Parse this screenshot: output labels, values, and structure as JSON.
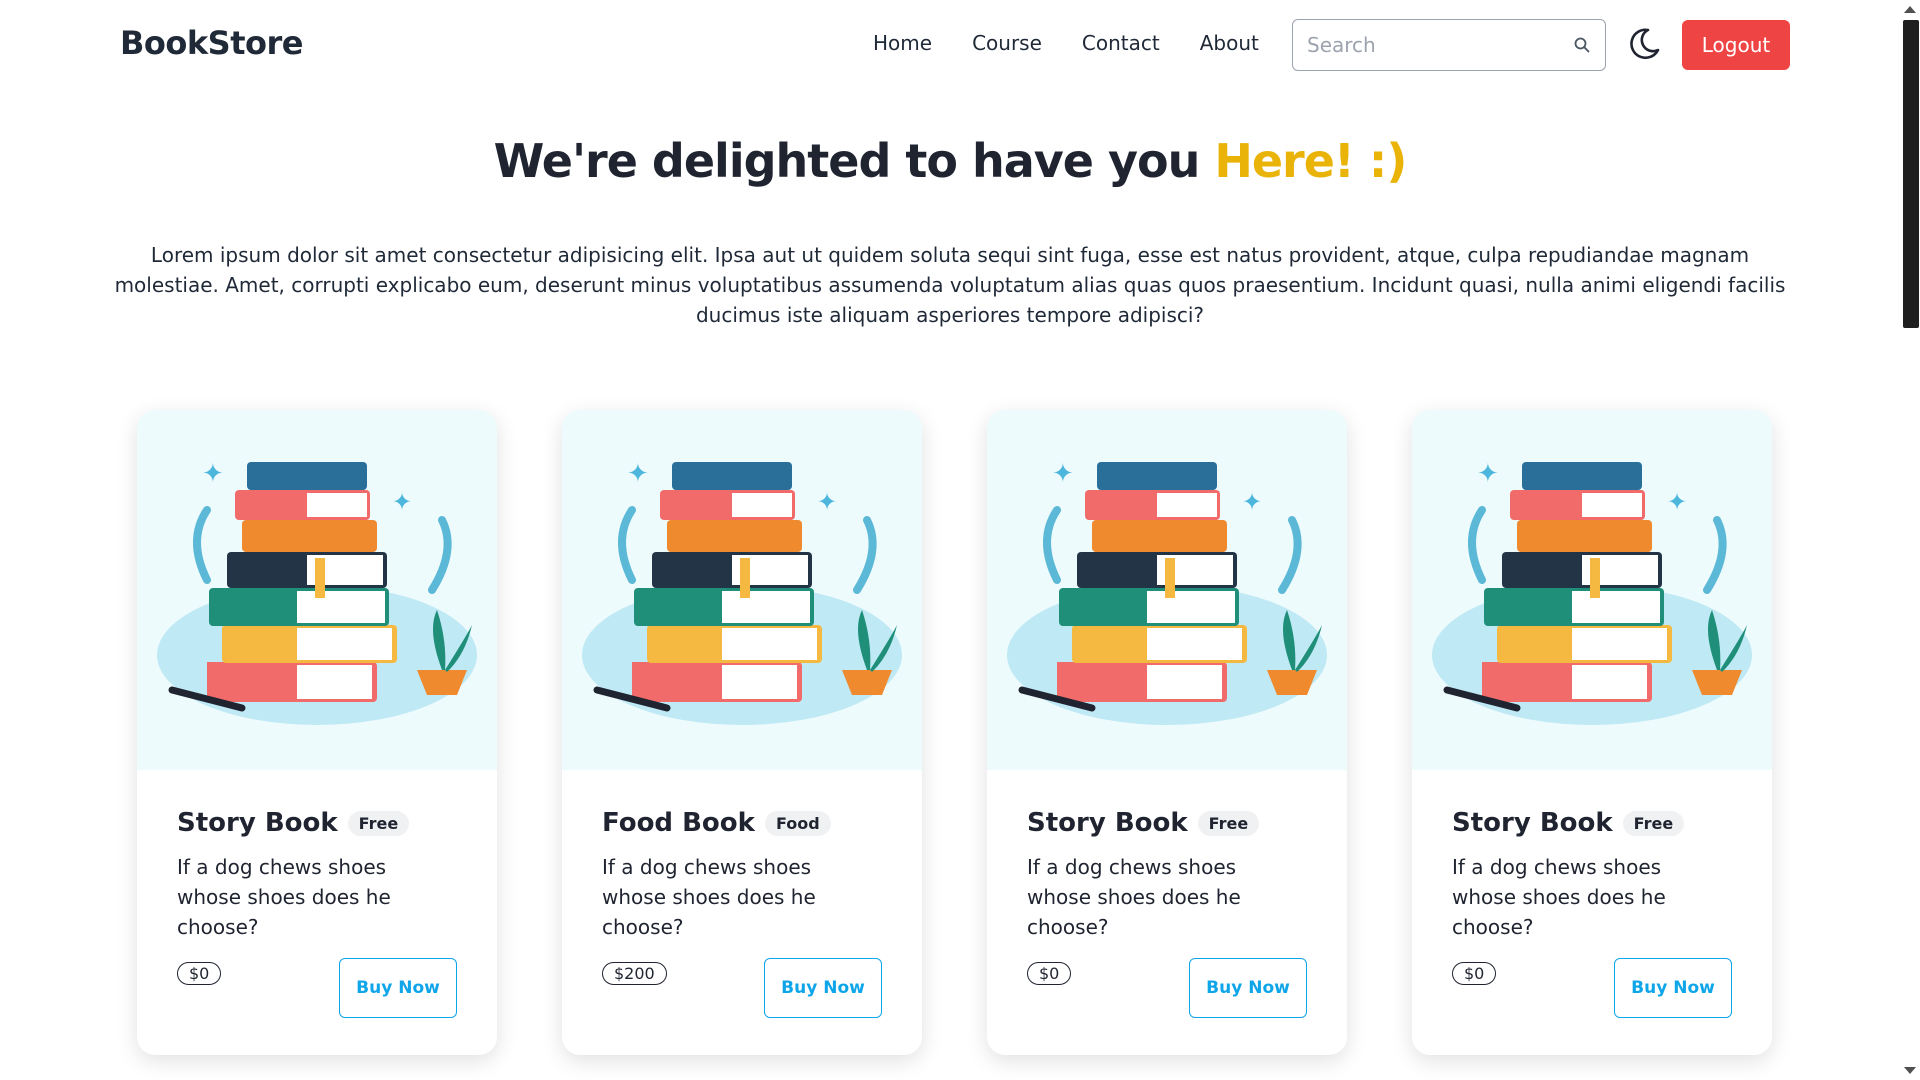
{
  "navbar": {
    "brand": "BookStore",
    "links": [
      "Home",
      "Course",
      "Contact",
      "About"
    ],
    "search_placeholder": "Search",
    "logout_label": "Logout"
  },
  "hero": {
    "heading_main": "We're delighted to have you ",
    "heading_accent": "Here! :)",
    "description": "Lorem ipsum dolor sit amet consectetur adipisicing elit. Ipsa aut ut quidem soluta sequi sint fuga, esse est natus provident, atque, culpa repudiandae magnam molestiae. Amet, corrupti explicabo eum, deserunt minus voluptatibus assumenda voluptatum alias quas quos praesentium. Incidunt quasi, nulla animi eligendi facilis ducimus iste aliquam asperiores tempore adipisci?"
  },
  "cards": [
    {
      "title": "Story Book",
      "badge": "Free",
      "description": "If a dog chews shoes whose shoes does he choose?",
      "price": "$0",
      "button": "Buy Now"
    },
    {
      "title": "Food Book",
      "badge": "Food",
      "description": "If a dog chews shoes whose shoes does he choose?",
      "price": "$200",
      "button": "Buy Now"
    },
    {
      "title": "Story Book",
      "badge": "Free",
      "description": "If a dog chews shoes whose shoes does he choose?",
      "price": "$0",
      "button": "Buy Now"
    },
    {
      "title": "Story Book",
      "badge": "Free",
      "description": "If a dog chews shoes whose shoes does he choose?",
      "price": "$0",
      "button": "Buy Now"
    }
  ],
  "colors": {
    "accent": "#eab308",
    "logout": "#ef4444",
    "buy_button": "#0ea5e9",
    "card_figure_bg": "#eefbfd"
  },
  "icons": {
    "search": "search-icon",
    "theme_toggle": "moon-icon",
    "card_figure": "books-stack-illustration"
  }
}
